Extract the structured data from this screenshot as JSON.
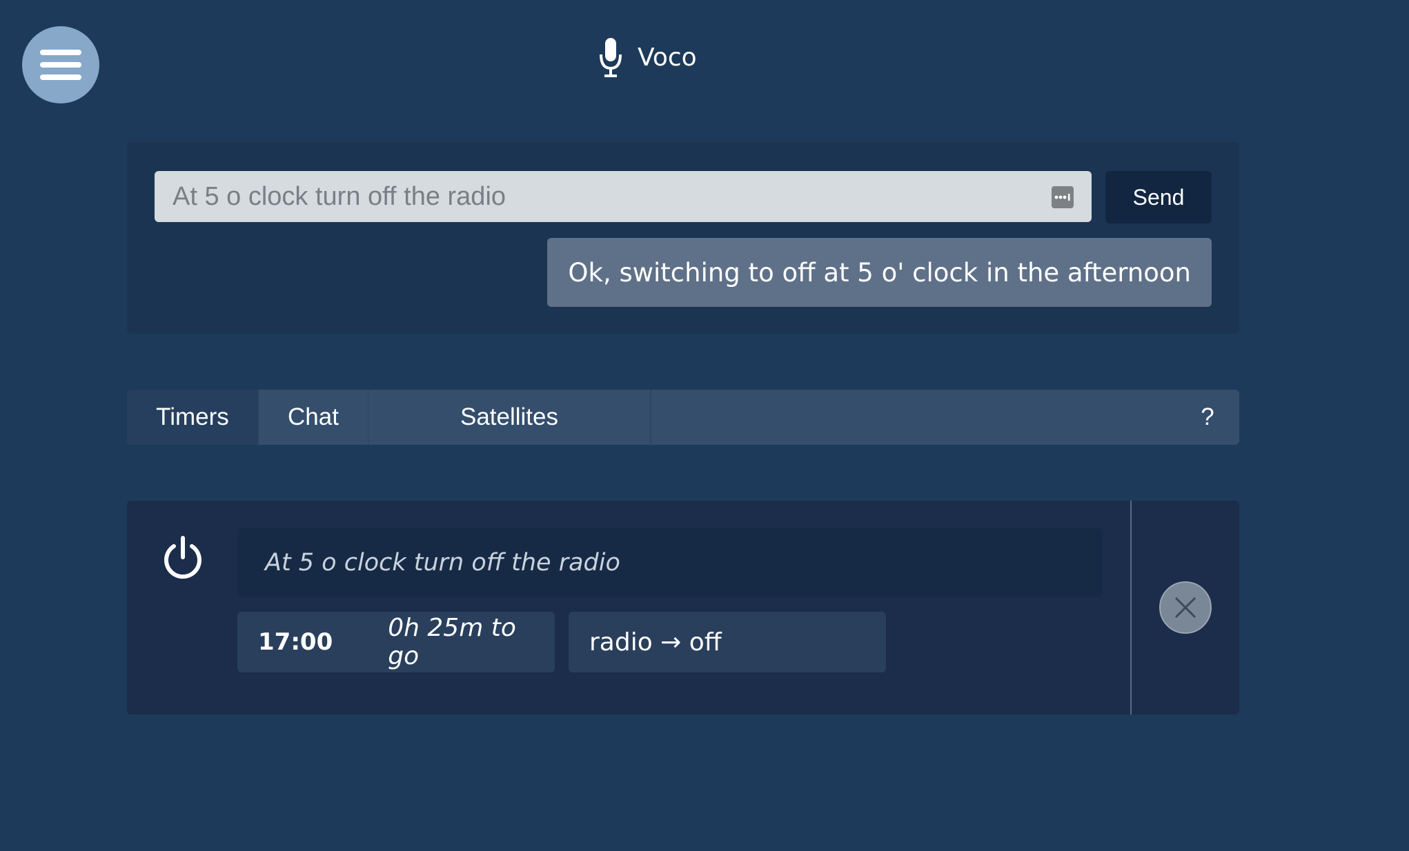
{
  "header": {
    "app_title": "Voco",
    "menu_icon": "hamburger-menu-icon",
    "title_icon": "microphone-icon"
  },
  "command": {
    "input_value": "",
    "input_placeholder": "At 5 o clock turn off the radio",
    "password_icon": "password-manager-icon",
    "send_label": "Send",
    "response": "Ok, switching to off at 5 o' clock in the afternoon"
  },
  "tabs": {
    "items": [
      {
        "label": "Timers",
        "active": true
      },
      {
        "label": "Chat",
        "active": false
      },
      {
        "label": "Satellites",
        "active": false
      }
    ],
    "help_label": "?"
  },
  "timers": [
    {
      "icon": "power-icon",
      "text": "At 5 o clock turn off the radio",
      "time": "17:00",
      "remaining": "0h 25m to go",
      "action": "radio → off",
      "delete_icon": "close-icon"
    }
  ],
  "colors": {
    "background": "#1d3a5a",
    "panel": "#1b3452",
    "tab_active": "#263f5e",
    "tab_bar": "#344e6c",
    "bubble": "#5f7189",
    "send_button": "#122641",
    "menu_button": "#87a8c8"
  }
}
